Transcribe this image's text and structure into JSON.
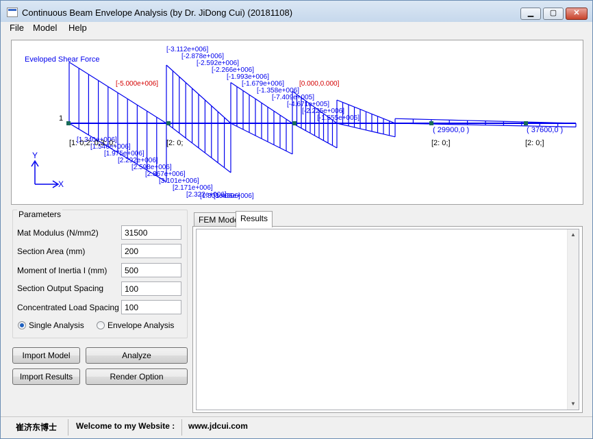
{
  "window": {
    "title": "Continuous Beam Envelope Analysis (by Dr. JiDong Cui) (20181108)",
    "icon_text": "SUN BEAM"
  },
  "menu": [
    "File",
    "Model",
    "Help"
  ],
  "canvas": {
    "caption": "Eveloped Shear Force",
    "axis_y": "Y",
    "axis_x": "X",
    "node_number": "1",
    "coord_labels": [
      "( 29900,0 )",
      "( 37600,0 )"
    ],
    "span_labels": [
      "[1: 0;2: 0;3: 0;",
      "[2: 0;",
      "[2: 0;]",
      "[2: 0;]"
    ],
    "values_top": [
      "[-3.112e+006]",
      "[-2.878e+006]",
      "[-2.592e+006]",
      "[-2.266e+006]",
      "[-1.993e+006]",
      "[-1.679e+006]",
      "[-1.358e+006]",
      "[-7.409e+005]",
      "[-4.671e+005]",
      "[-2.225e+006]",
      "[-1.555e+006]"
    ],
    "values_bottom": [
      "[1.340e+006]",
      "[1.546e+006]",
      "[1.975e+006]",
      "[2.292e+006]",
      "[2.598e+006]",
      "[2.867e+006]",
      "[3.101e+006]",
      "[2.171e+006]",
      "[2.322e+006]",
      "[1.803e+006]",
      "[1.406e+006]"
    ],
    "red_values": [
      "[-5.000e+006]",
      "[0.000,0.000]"
    ]
  },
  "parameters": {
    "group_title": "Parameters",
    "fields": [
      {
        "label": "Mat Modulus (N/mm2)",
        "value": "31500"
      },
      {
        "label": "Section Area  (mm)",
        "value": "200"
      },
      {
        "label": "Moment of Inertia I (mm)",
        "value": "500"
      },
      {
        "label": "Section Output Spacing",
        "value": "100"
      },
      {
        "label": "Concentrated Load Spacing",
        "value": "100"
      }
    ],
    "radio_single": "Single Analysis",
    "radio_envelope": "Envelope Analysis",
    "selected": "single"
  },
  "buttons": {
    "import_model": "Import Model",
    "analyze": "Analyze",
    "import_results": "Import Results",
    "render_option": "Render Option"
  },
  "tabs": {
    "fem_model": "FEM Model",
    "results": "Results",
    "active": "Results"
  },
  "status": {
    "author": "崔济东博士",
    "welcome": "Welcome to my Website :",
    "website": "www.jdcui.com"
  },
  "colors": {
    "diagram_blue": "#0000ee",
    "diagram_red": "#d40000",
    "beam_node": "#1a6b5a"
  }
}
